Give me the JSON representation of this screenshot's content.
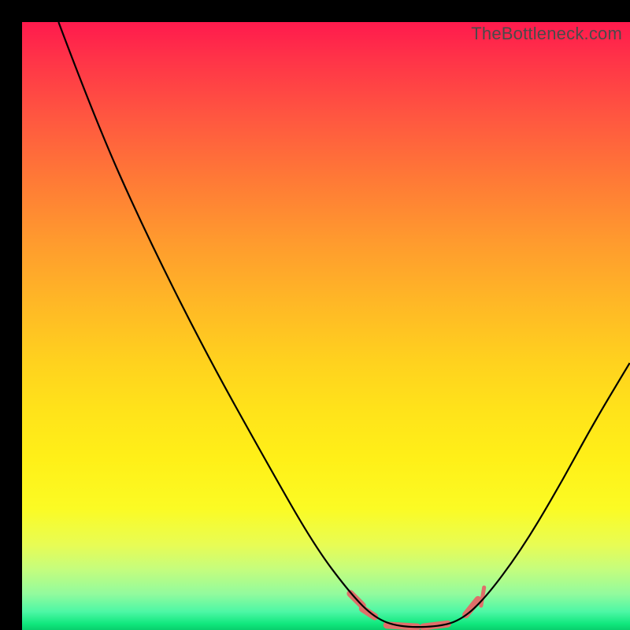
{
  "watermark": "TheBottleneck.com",
  "chart_data": {
    "type": "line",
    "title": "",
    "xlabel": "",
    "ylabel": "",
    "xlim": [
      0,
      100
    ],
    "ylim": [
      0,
      100
    ],
    "gradient_stops": [
      {
        "pos": 0,
        "color": "#ff1a4d"
      },
      {
        "pos": 36,
        "color": "#ff9a2e"
      },
      {
        "pos": 72,
        "color": "#fff018"
      },
      {
        "pos": 90,
        "color": "#c5fd7d"
      },
      {
        "pos": 100,
        "color": "#09cf6d"
      }
    ],
    "series": [
      {
        "name": "bottleneck-curve",
        "color": "#000000",
        "points": [
          {
            "x": 6,
            "y": 100
          },
          {
            "x": 12,
            "y": 84
          },
          {
            "x": 20,
            "y": 66
          },
          {
            "x": 30,
            "y": 46
          },
          {
            "x": 40,
            "y": 28
          },
          {
            "x": 48,
            "y": 14
          },
          {
            "x": 54,
            "y": 6
          },
          {
            "x": 58,
            "y": 2
          },
          {
            "x": 62,
            "y": 0.5
          },
          {
            "x": 68,
            "y": 0.5
          },
          {
            "x": 72,
            "y": 1.5
          },
          {
            "x": 76,
            "y": 5
          },
          {
            "x": 82,
            "y": 13
          },
          {
            "x": 88,
            "y": 23
          },
          {
            "x": 94,
            "y": 34
          },
          {
            "x": 100,
            "y": 44
          }
        ]
      }
    ],
    "markers": [
      {
        "name": "stub-left",
        "x1": 54,
        "y1": 6,
        "x2": 56,
        "y2": 4,
        "color": "#df6f6a",
        "width": 9
      },
      {
        "name": "stub-left2",
        "x1": 56,
        "y1": 3.5,
        "x2": 58,
        "y2": 2.2,
        "color": "#df6f6a",
        "width": 9
      },
      {
        "name": "stub-bottom1",
        "x1": 60,
        "y1": 0.8,
        "x2": 65,
        "y2": 0.5,
        "color": "#df6f6a",
        "width": 9
      },
      {
        "name": "stub-bottom2",
        "x1": 66,
        "y1": 0.5,
        "x2": 70,
        "y2": 1.0,
        "color": "#df6f6a",
        "width": 9
      },
      {
        "name": "stub-right",
        "x1": 73,
        "y1": 2.5,
        "x2": 75,
        "y2": 5.0,
        "color": "#df6f6a",
        "width": 9
      },
      {
        "name": "stub-right-tick",
        "x1": 75.5,
        "y1": 4.0,
        "x2": 76.0,
        "y2": 7.0,
        "color": "#df6f6a",
        "width": 5
      }
    ]
  }
}
